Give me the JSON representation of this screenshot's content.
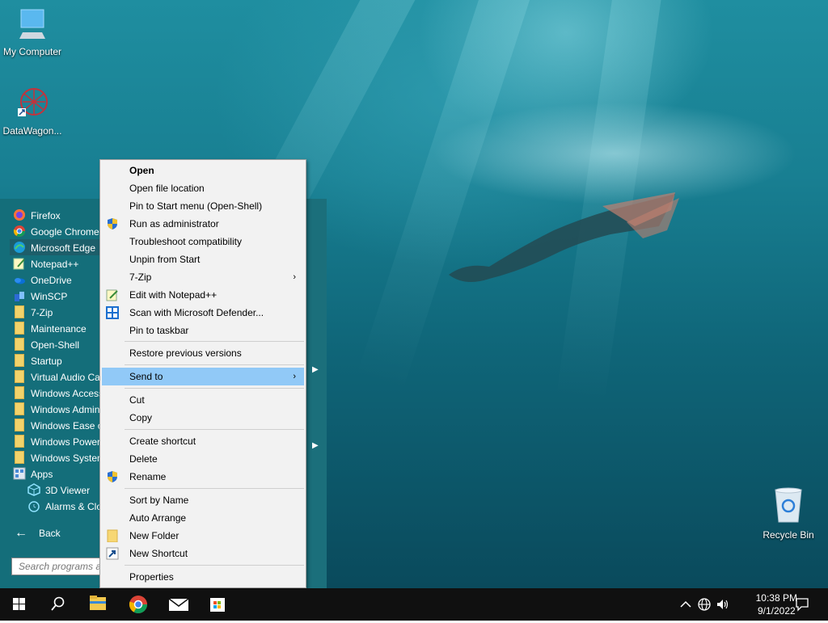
{
  "desktop": {
    "icons": [
      {
        "label": "My Computer",
        "icon": "computer-icon"
      },
      {
        "label": "DataWagon...",
        "icon": "datawagon-icon"
      },
      {
        "label": "Recycle Bin",
        "icon": "recycle-bin-icon"
      }
    ]
  },
  "start_menu": {
    "programs": [
      {
        "label": "Firefox",
        "icon": "firefox-icon"
      },
      {
        "label": "Google Chrome",
        "icon": "chrome-icon"
      },
      {
        "label": "Microsoft Edge",
        "icon": "edge-icon"
      },
      {
        "label": "Notepad++",
        "icon": "notepadpp-icon"
      },
      {
        "label": "OneDrive",
        "icon": "onedrive-icon"
      },
      {
        "label": "WinSCP",
        "icon": "winscp-icon"
      },
      {
        "label": "7-Zip",
        "icon": "folder-icon"
      },
      {
        "label": "Maintenance",
        "icon": "folder-icon"
      },
      {
        "label": "Open-Shell",
        "icon": "folder-icon"
      },
      {
        "label": "Startup",
        "icon": "folder-icon"
      },
      {
        "label": "Virtual Audio Ca",
        "icon": "folder-icon"
      },
      {
        "label": "Windows Access",
        "icon": "folder-icon"
      },
      {
        "label": "Windows Admin",
        "icon": "folder-icon"
      },
      {
        "label": "Windows Ease o",
        "icon": "folder-icon"
      },
      {
        "label": "Windows Power",
        "icon": "folder-icon"
      },
      {
        "label": "Windows System",
        "icon": "folder-icon"
      },
      {
        "label": "Apps",
        "icon": "apps-icon"
      },
      {
        "label": "3D Viewer",
        "icon": "3d-viewer-icon"
      },
      {
        "label": "Alarms & Clo",
        "icon": "alarms-clock-icon"
      }
    ],
    "back_label": "Back",
    "search_placeholder": "Search programs a"
  },
  "context_menu": {
    "items": [
      {
        "label": "Open",
        "bold": true
      },
      {
        "label": "Open file location"
      },
      {
        "label": "Pin to Start menu (Open-Shell)"
      },
      {
        "label": "Run as administrator",
        "icon": "uac-shield-icon"
      },
      {
        "label": "Troubleshoot compatibility"
      },
      {
        "label": "Unpin from Start"
      },
      {
        "label": "7-Zip",
        "submenu": true
      },
      {
        "label": "Edit with Notepad++",
        "icon": "notepadpp-icon"
      },
      {
        "label": "Scan with Microsoft Defender...",
        "icon": "defender-icon"
      },
      {
        "label": "Pin to taskbar"
      },
      {
        "label": "Restore previous versions"
      },
      {
        "label": "Send to",
        "submenu": true,
        "highlighted": true
      },
      {
        "label": "Cut"
      },
      {
        "label": "Copy"
      },
      {
        "label": "Create shortcut"
      },
      {
        "label": "Delete"
      },
      {
        "label": "Rename",
        "icon": "uac-shield-icon"
      },
      {
        "label": "Sort by Name"
      },
      {
        "label": "Auto Arrange"
      },
      {
        "label": "New Folder",
        "icon": "folder-icon"
      },
      {
        "label": "New Shortcut",
        "icon": "shortcut-icon"
      },
      {
        "label": "Properties"
      }
    ],
    "submenu_arrow": "›"
  },
  "taskbar": {
    "items": [
      "start-windows-icon",
      "search-icon",
      "file-explorer-icon",
      "chrome-icon",
      "mail-icon",
      "store-icon"
    ],
    "tray": [
      "chevron-up-icon",
      "network-icon",
      "volume-icon"
    ],
    "time": "10:38 PM",
    "date": "9/1/2022",
    "notification_icon": "action-center-icon"
  },
  "colors": {
    "selection": "#91c9f7",
    "taskbar": "#101010",
    "menu_bg": "#f2f2f2"
  }
}
